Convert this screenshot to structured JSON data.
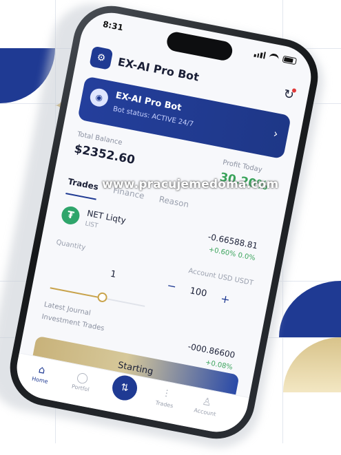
{
  "status_bar": {
    "time": "8:31"
  },
  "header": {
    "app_title": "EX-AI Pro Bot",
    "logo_icon": "robot-icon",
    "refresh_icon": "refresh-icon"
  },
  "bot_card": {
    "name": "EX-AI Pro Bot",
    "subtitle": "Bot status: ACTIVE 24/7",
    "chevron": "›"
  },
  "stats": {
    "left_label": "Total Balance",
    "left_value": "$2352.60",
    "right_label": "Profit Today",
    "right_value": "30.20%"
  },
  "tabs": [
    {
      "label": "Trades"
    },
    {
      "label": "Finance"
    },
    {
      "label": "Reason"
    }
  ],
  "watermark": "www.pracujemedoma.com",
  "coin": {
    "name": "NET Liqty",
    "sub": "LIST",
    "value": "-0.66588.81",
    "change": "+0.60% 0.0%"
  },
  "params": {
    "left_label": "Quantity",
    "right_label": "Account USD USDT"
  },
  "stepper": {
    "qty": "1",
    "minus": "−",
    "amount": "100",
    "plus": "+"
  },
  "slider": {
    "level": 0.55
  },
  "risk": {
    "line1": "Latest Journal",
    "line2": "Investment Trades",
    "value1": "-000.86600",
    "value2": "+0.08%"
  },
  "start_button": {
    "label": "Starting"
  },
  "bottom_nav": [
    {
      "label": "Home",
      "icon": "⌂"
    },
    {
      "label": "Portfol",
      "icon": "◯"
    },
    {
      "label": "Trades",
      "icon": "⫶"
    },
    {
      "label": "Account",
      "icon": "♙"
    }
  ],
  "bottom_nav_center_icon": "⇅"
}
